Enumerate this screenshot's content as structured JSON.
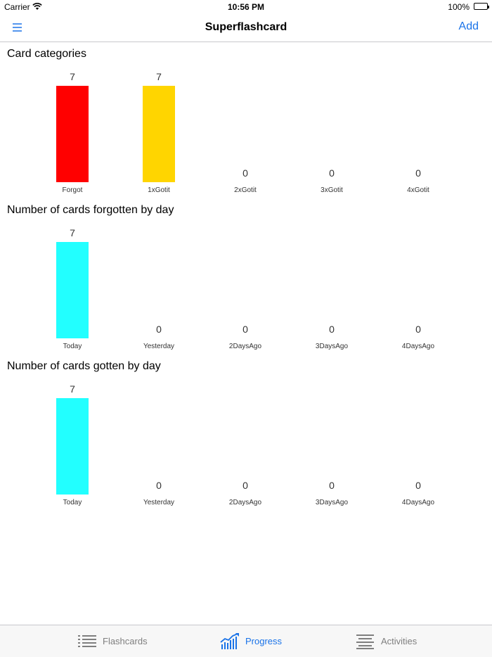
{
  "status_bar": {
    "carrier": "Carrier",
    "time": "10:56 PM",
    "battery": "100%"
  },
  "nav": {
    "title": "Superflashcard",
    "add_label": "Add",
    "menu_icon": "menu-icon"
  },
  "sections": [
    {
      "title": "Card categories"
    },
    {
      "title": "Number of cards forgotten by day"
    },
    {
      "title": "Number of cards gotten by day"
    }
  ],
  "chart_data": [
    {
      "type": "bar",
      "title": "Card categories",
      "categories": [
        "Forgot",
        "1xGotit",
        "2xGotit",
        "3xGotit",
        "4xGotit"
      ],
      "values": [
        7,
        7,
        0,
        0,
        0
      ],
      "colors": [
        "#ff0000",
        "#ffd500",
        "#ffffff",
        "#ffffff",
        "#ffffff"
      ],
      "ylim": [
        0,
        7
      ],
      "grid": false
    },
    {
      "type": "bar",
      "title": "Number of cards forgotten by day",
      "categories": [
        "Today",
        "Yesterday",
        "2DaysAgo",
        "3DaysAgo",
        "4DaysAgo"
      ],
      "values": [
        7,
        0,
        0,
        0,
        0
      ],
      "colors": [
        "#22ffff",
        "#22ffff",
        "#22ffff",
        "#22ffff",
        "#22ffff"
      ],
      "ylim": [
        0,
        7
      ],
      "grid": false
    },
    {
      "type": "bar",
      "title": "Number of cards gotten by day",
      "categories": [
        "Today",
        "Yesterday",
        "2DaysAgo",
        "3DaysAgo",
        "4DaysAgo"
      ],
      "values": [
        7,
        0,
        0,
        0,
        0
      ],
      "colors": [
        "#22ffff",
        "#22ffff",
        "#22ffff",
        "#22ffff",
        "#22ffff"
      ],
      "ylim": [
        0,
        7
      ],
      "grid": false
    }
  ],
  "tabs": [
    {
      "label": "Flashcards",
      "icon": "list-icon",
      "active": false
    },
    {
      "label": "Progress",
      "icon": "chart-icon",
      "active": true
    },
    {
      "label": "Activities",
      "icon": "lines-icon",
      "active": false
    }
  ],
  "colors": {
    "accent": "#1a73e8",
    "inactive": "#7f7f7f"
  }
}
